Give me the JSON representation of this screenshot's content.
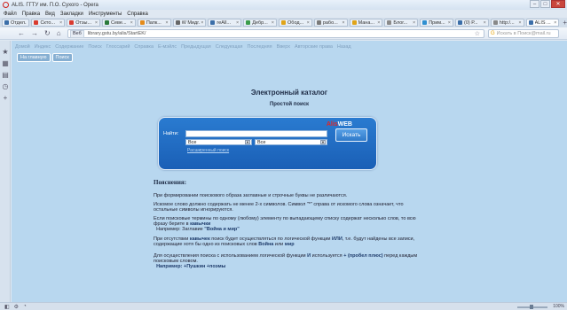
{
  "window": {
    "title": "ALIS. ГГТУ им. П.О. Сухого - Opera",
    "controls": [
      "–",
      "□",
      "✕"
    ]
  },
  "menu": [
    "Файл",
    "Правка",
    "Вид",
    "Закладки",
    "Инструменты",
    "Справка"
  ],
  "tabs": [
    {
      "label": "Отдел...",
      "color": "#3b6ea8"
    },
    {
      "label": "Скто...",
      "color": "#d93b2f"
    },
    {
      "label": "Отзы...",
      "color": "#d93b2f"
    },
    {
      "label": "Севе...",
      "color": "#2b7a3b"
    },
    {
      "label": "Папк...",
      "color": "#e48b1a"
    },
    {
      "label": "W Мидг...",
      "color": "#666666"
    },
    {
      "label": "reAll...",
      "color": "#3b6ea8"
    },
    {
      "label": "Дебр...",
      "color": "#3b9c4a"
    },
    {
      "label": "Обод...",
      "color": "#e0a419"
    },
    {
      "label": "рабо...",
      "color": "#7a7a7a"
    },
    {
      "label": "Мана...",
      "color": "#e0a419"
    },
    {
      "label": "Блог...",
      "color": "#8a8a8a"
    },
    {
      "label": "Прим...",
      "color": "#2f8fd0"
    },
    {
      "label": "(0) Р...",
      "color": "#3b6ea8"
    },
    {
      "label": "http:/...",
      "color": "#888888"
    },
    {
      "label": "ALIS ...",
      "color": "#3b6ea8",
      "active": true
    }
  ],
  "address": {
    "badge": "Веб",
    "url": "library.gstu.by/alis/StartEK/",
    "search_engine": "G",
    "search_placeholder": "Искать в Поиск@mail.ru"
  },
  "page": {
    "nav_links": [
      "Домой",
      "Индекс",
      "Содержание",
      "Поиск",
      "Глоссарий",
      "Справка",
      "Е-мэйлс",
      "Предыдущая",
      "Следующая",
      "Последняя",
      "Вверх",
      "Авторские права",
      "Назад"
    ],
    "buttons": [
      "На главную",
      "Поиск"
    ],
    "title": "Электронный каталог",
    "subtitle": "Простой поиск",
    "search": {
      "brand_a": "Alis",
      "brand_b": "WEB",
      "find_label": "Найти:",
      "query_value": "",
      "select1_value": "Все",
      "select2_value": "Все",
      "advanced_link": "Расширенный поиск",
      "button_label": "Искать"
    },
    "explain": {
      "heading": "Пояснения:",
      "p1": "При формировании поискового образа заглавные и строчные буквы не различаются.",
      "p2": "Искомое слово должно содержать не менее 2-х символов. Символ \"*\" справа от искомого слова означает, что остальные символы игнорируются.",
      "p3": "Если поисковые термины по одному (любому) элементу по выпадающему списку содержат несколько слов, то всю фразу берите в",
      "p3_kw": "кавычки",
      "p3_example_prefix": "Например: Заглавие",
      "p3_example_kw": "\"Война и мир\"",
      "p4_a": "При отсутствии",
      "p4_kw1": "кавычек",
      "p4_b": "поиск будет осуществляться по логической функции",
      "p4_kw2": "ИЛИ",
      "p4_c": ", т.е. будут найдены все записи, содержащие хотя бы одно из поисковых слов",
      "p4_kw3": "Война",
      "p4_d": "или",
      "p4_kw4": "мир",
      "p5_a": "Для осуществления поиска с использованием логической функции",
      "p5_kw1": "И",
      "p5_b": "используется",
      "p5_kw2": "+ (пробел плюс)",
      "p5_c": "перед каждым поисковым словом.",
      "p5_example": "Например: +Пушкин +поэмы"
    }
  },
  "status": {
    "icons": [
      "◧",
      "⚙",
      "◔"
    ],
    "zoom": "100%"
  }
}
